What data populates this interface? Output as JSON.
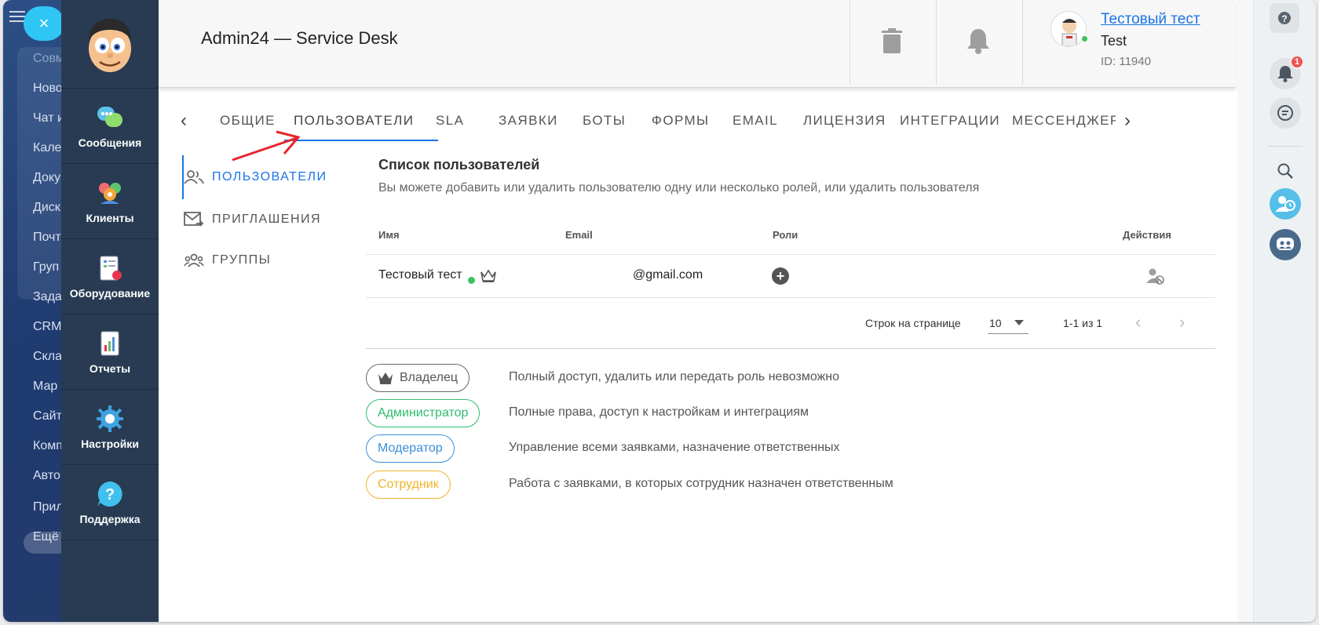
{
  "bitrix_menu": {
    "items": [
      "Совм",
      "Ново",
      "Чат и",
      "Кале",
      "Доку",
      "Диск",
      "Почт",
      "Груп",
      "Зада",
      "CRM",
      "Скла",
      "Мар",
      "Сайт",
      "Комп",
      "Авто",
      "Прил",
      "Ещё"
    ]
  },
  "nav": {
    "items": [
      {
        "label": "Сообщения",
        "icon": "messages-icon"
      },
      {
        "label": "Клиенты",
        "icon": "clients-icon"
      },
      {
        "label": "Оборудование",
        "icon": "equipment-icon"
      },
      {
        "label": "Отчеты",
        "icon": "reports-icon"
      },
      {
        "label": "Настройки",
        "icon": "settings-icon"
      },
      {
        "label": "Поддержка",
        "icon": "support-icon"
      }
    ]
  },
  "header": {
    "title": "Admin24 — Service Desk",
    "user": {
      "name": "Тестовый тест",
      "role": "Test",
      "id": "ID: 11940"
    }
  },
  "tabs": {
    "items": [
      "ОБЩИЕ",
      "ПОЛЬЗОВАТЕЛИ",
      "SLA",
      "ЗАЯВКИ",
      "БОТЫ",
      "ФОРМЫ",
      "EMAIL",
      "ЛИЦЕНЗИЯ",
      "ИНТЕГРАЦИИ",
      "МЕССЕНДЖЕРЫ"
    ],
    "active": "ПОЛЬЗОВАТЕЛИ"
  },
  "side_menu": {
    "items": [
      {
        "label": "ПОЛЬЗОВАТЕЛИ",
        "icon": "users-icon",
        "active": true
      },
      {
        "label": "ПРИГЛАШЕНИЯ",
        "icon": "invite-mail-icon",
        "active": false
      },
      {
        "label": "ГРУППЫ",
        "icon": "groups-icon",
        "active": false
      }
    ]
  },
  "users_list": {
    "title": "Список пользователей",
    "subtitle": "Вы можете добавить или удалить пользователю одну или несколько ролей, или удалить пользователя",
    "columns": [
      "Имя",
      "Email",
      "Роли",
      "Действия"
    ],
    "rows": [
      {
        "name": "Тестовый тест",
        "email": "@gmail.com"
      }
    ],
    "pagination": {
      "rows_label": "Строк на странице",
      "rows_value": "10",
      "range": "1-1 из 1"
    }
  },
  "roles": [
    {
      "label": "Владелец",
      "description": "Полный доступ, удалить или передать роль невозможно",
      "color": "#666666"
    },
    {
      "label": "Администратор",
      "description": "Полные права, доступ к настройкам и интеграциям",
      "color": "#2dbd6e"
    },
    {
      "label": "Модератор",
      "description": "Управление всеми заявками, назначение ответственных",
      "color": "#3a8fd9"
    },
    {
      "label": "Сотрудник",
      "description": "Работа с заявками, в которых сотрудник назначен ответственным",
      "color": "#f0b429"
    }
  ],
  "right_bar": {
    "notifications_count": "1"
  }
}
